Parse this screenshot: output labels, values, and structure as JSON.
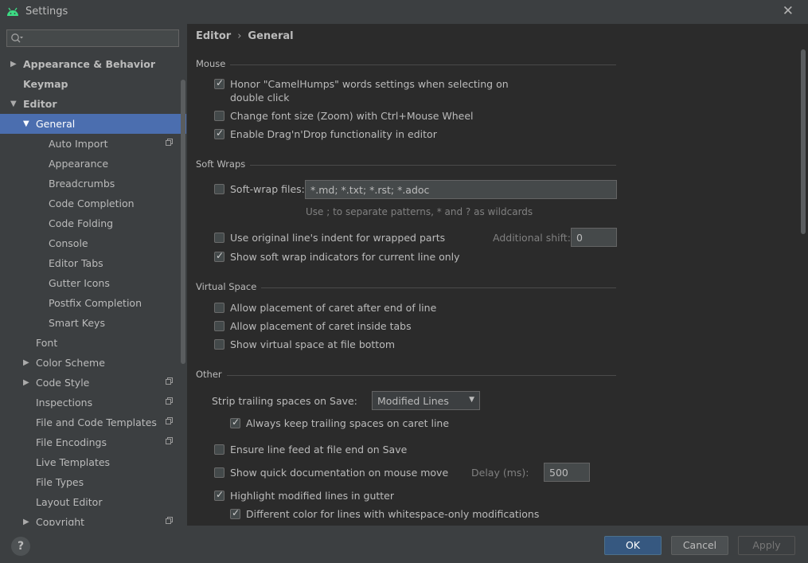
{
  "window": {
    "title": "Settings"
  },
  "search": {
    "placeholder": ""
  },
  "tree": [
    {
      "label": "Appearance & Behavior",
      "indent": 0,
      "arrow": "▶",
      "bold": true,
      "icon": false,
      "selected": false
    },
    {
      "label": "Keymap",
      "indent": 0,
      "arrow": "",
      "bold": true,
      "icon": false,
      "selected": false
    },
    {
      "label": "Editor",
      "indent": 0,
      "arrow": "▼",
      "bold": true,
      "icon": false,
      "selected": false
    },
    {
      "label": "General",
      "indent": 1,
      "arrow": "▼",
      "bold": false,
      "icon": false,
      "selected": true
    },
    {
      "label": "Auto Import",
      "indent": 2,
      "arrow": "",
      "bold": false,
      "icon": true,
      "selected": false
    },
    {
      "label": "Appearance",
      "indent": 2,
      "arrow": "",
      "bold": false,
      "icon": false,
      "selected": false
    },
    {
      "label": "Breadcrumbs",
      "indent": 2,
      "arrow": "",
      "bold": false,
      "icon": false,
      "selected": false
    },
    {
      "label": "Code Completion",
      "indent": 2,
      "arrow": "",
      "bold": false,
      "icon": false,
      "selected": false
    },
    {
      "label": "Code Folding",
      "indent": 2,
      "arrow": "",
      "bold": false,
      "icon": false,
      "selected": false
    },
    {
      "label": "Console",
      "indent": 2,
      "arrow": "",
      "bold": false,
      "icon": false,
      "selected": false
    },
    {
      "label": "Editor Tabs",
      "indent": 2,
      "arrow": "",
      "bold": false,
      "icon": false,
      "selected": false
    },
    {
      "label": "Gutter Icons",
      "indent": 2,
      "arrow": "",
      "bold": false,
      "icon": false,
      "selected": false
    },
    {
      "label": "Postfix Completion",
      "indent": 2,
      "arrow": "",
      "bold": false,
      "icon": false,
      "selected": false
    },
    {
      "label": "Smart Keys",
      "indent": 2,
      "arrow": "",
      "bold": false,
      "icon": false,
      "selected": false
    },
    {
      "label": "Font",
      "indent": 1,
      "arrow": "",
      "bold": false,
      "icon": false,
      "selected": false
    },
    {
      "label": "Color Scheme",
      "indent": 1,
      "arrow": "▶",
      "bold": false,
      "icon": false,
      "selected": false
    },
    {
      "label": "Code Style",
      "indent": 1,
      "arrow": "▶",
      "bold": false,
      "icon": true,
      "selected": false
    },
    {
      "label": "Inspections",
      "indent": 1,
      "arrow": "",
      "bold": false,
      "icon": true,
      "selected": false
    },
    {
      "label": "File and Code Templates",
      "indent": 1,
      "arrow": "",
      "bold": false,
      "icon": true,
      "selected": false
    },
    {
      "label": "File Encodings",
      "indent": 1,
      "arrow": "",
      "bold": false,
      "icon": true,
      "selected": false
    },
    {
      "label": "Live Templates",
      "indent": 1,
      "arrow": "",
      "bold": false,
      "icon": false,
      "selected": false
    },
    {
      "label": "File Types",
      "indent": 1,
      "arrow": "",
      "bold": false,
      "icon": false,
      "selected": false
    },
    {
      "label": "Layout Editor",
      "indent": 1,
      "arrow": "",
      "bold": false,
      "icon": false,
      "selected": false
    },
    {
      "label": "Copyright",
      "indent": 1,
      "arrow": "▶",
      "bold": false,
      "icon": true,
      "selected": false
    }
  ],
  "breadcrumb": {
    "parent": "Editor",
    "sep": "›",
    "current": "General"
  },
  "sections": {
    "mouse": "Mouse",
    "soft_wraps": "Soft Wraps",
    "virtual_space": "Virtual Space",
    "other": "Other"
  },
  "mouse": {
    "camelhumps_line1": "Honor \"CamelHumps\" words settings when selecting on",
    "camelhumps_line2": "double click",
    "camelhumps_checked": true,
    "zoom_label": "Change font size (Zoom) with Ctrl+Mouse Wheel",
    "zoom_checked": false,
    "dnd_label": "Enable Drag'n'Drop functionality in editor",
    "dnd_checked": true
  },
  "soft_wraps": {
    "files_label": "Soft-wrap files:",
    "files_checked": false,
    "files_value": "*.md; *.txt; *.rst; *.adoc",
    "hint": "Use ; to separate patterns, * and ? as wildcards",
    "indent_label": "Use original line's indent for wrapped parts",
    "indent_checked": false,
    "shift_label": "Additional shift:",
    "shift_value": "0",
    "indicators_label": "Show soft wrap indicators for current line only",
    "indicators_checked": true
  },
  "virtual_space": {
    "after_eol_label": "Allow placement of caret after end of line",
    "inside_tabs_label": "Allow placement of caret inside tabs",
    "file_bottom_label": "Show virtual space at file bottom"
  },
  "other": {
    "strip_label": "Strip trailing spaces on Save:",
    "strip_value": "Modified Lines",
    "keep_label": "Always keep trailing spaces on caret line",
    "keep_checked": true,
    "linefeed_label": "Ensure line feed at file end on Save",
    "linefeed_checked": false,
    "quickdoc_label": "Show quick documentation on mouse move",
    "quickdoc_checked": false,
    "delay_label": "Delay (ms):",
    "delay_value": "500",
    "highlight_label": "Highlight modified lines in gutter",
    "highlight_checked": true,
    "whitespace_label": "Different color for lines with whitespace-only modifications",
    "whitespace_checked": true
  },
  "footer": {
    "help": "?",
    "ok": "OK",
    "cancel": "Cancel",
    "apply": "Apply"
  },
  "colors": {
    "accent_selection": "#4b6eaf",
    "ok_button": "#365880",
    "android_green": "#3ddc84"
  }
}
